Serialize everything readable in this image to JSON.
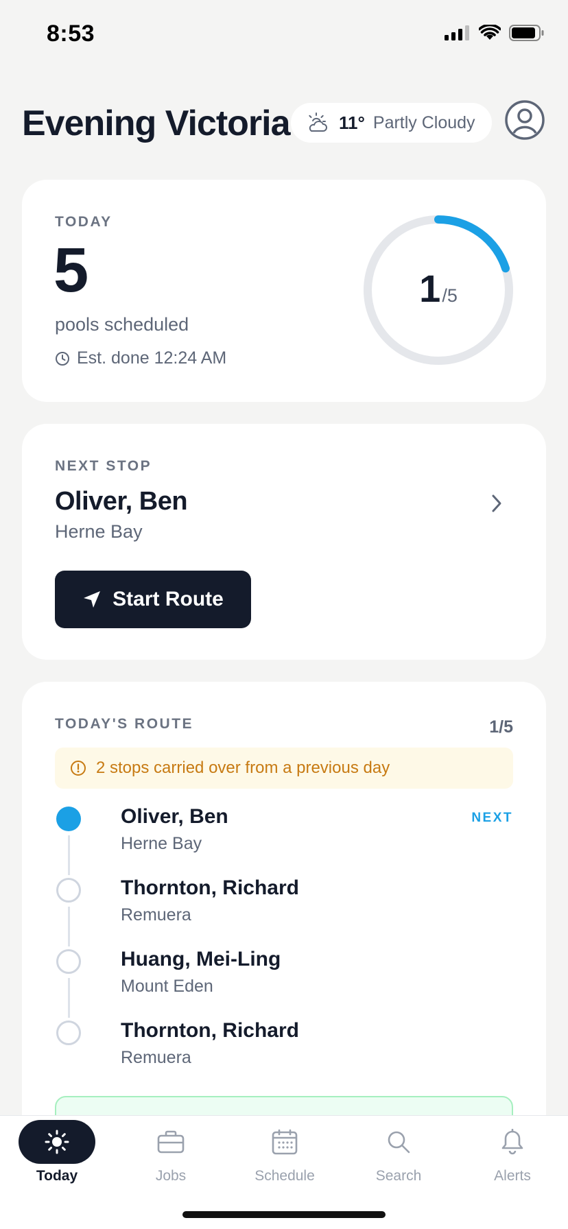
{
  "status_bar": {
    "time": "8:53"
  },
  "header": {
    "title": "Evening Victoria",
    "weather": {
      "icon": "partly-cloudy-icon",
      "temp": "11°",
      "condition": "Partly Cloudy"
    },
    "avatar_icon": "user-avatar-icon"
  },
  "today": {
    "eyebrow": "TODAY",
    "count": "5",
    "subtitle": "pools scheduled",
    "eta": "Est. done 12:24 AM",
    "progress": {
      "done": "1",
      "total": "/5",
      "fraction": 0.2
    }
  },
  "next_stop": {
    "eyebrow": "NEXT STOP",
    "name": "Oliver, Ben",
    "area": "Herne Bay",
    "button_label": "Start Route"
  },
  "route": {
    "eyebrow": "TODAY'S ROUTE",
    "count": "1/5",
    "banner": "2 stops carried over from a previous day",
    "next_tag": "NEXT",
    "stops": [
      {
        "name": "Oliver, Ben",
        "area": "Herne Bay",
        "state": "next"
      },
      {
        "name": "Thornton, Richard",
        "area": "Remuera",
        "state": "pending"
      },
      {
        "name": "Huang, Mei-Ling",
        "area": "Mount Eden",
        "state": "pending"
      },
      {
        "name": "Thornton, Richard",
        "area": "Remuera",
        "state": "pending"
      }
    ]
  },
  "tabs": [
    {
      "label": "Today",
      "icon": "sun-icon",
      "active": true
    },
    {
      "label": "Jobs",
      "icon": "briefcase-icon",
      "active": false
    },
    {
      "label": "Schedule",
      "icon": "calendar-icon",
      "active": false
    },
    {
      "label": "Search",
      "icon": "search-icon",
      "active": false
    },
    {
      "label": "Alerts",
      "icon": "bell-icon",
      "active": false
    }
  ],
  "colors": {
    "accent": "#1ba0e5",
    "dark": "#141b2b",
    "warning": "#c77a12"
  }
}
